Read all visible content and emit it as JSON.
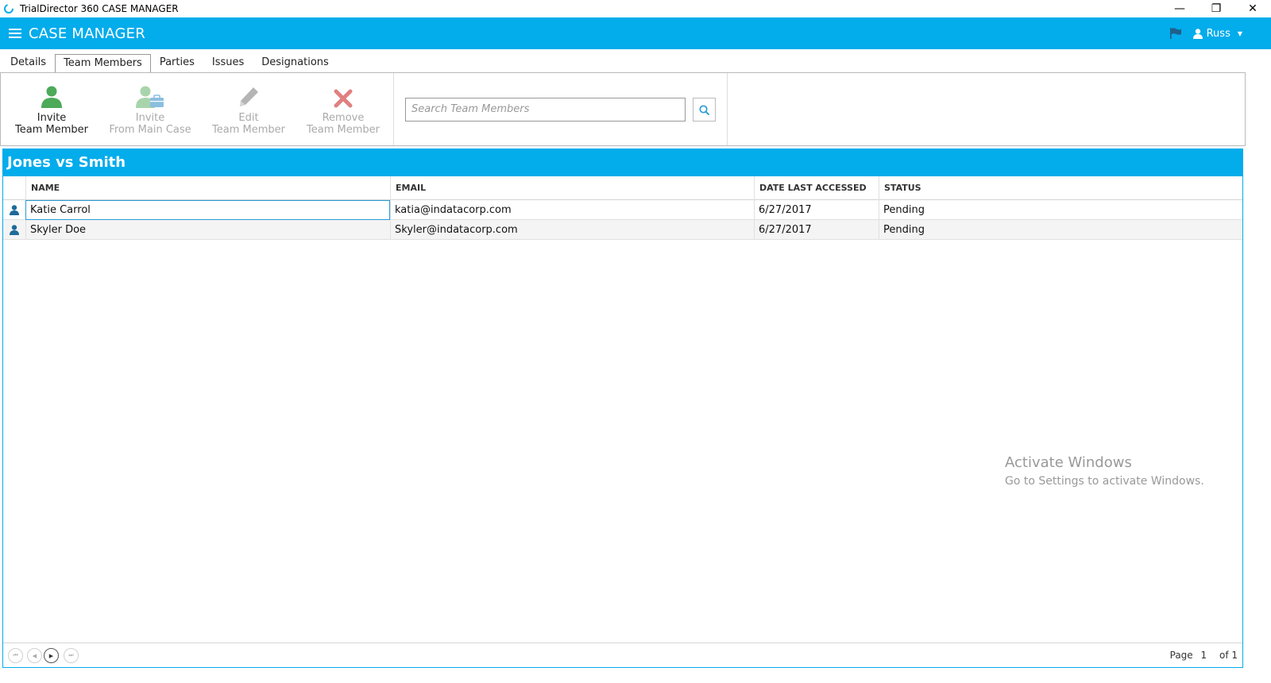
{
  "window": {
    "title": "TrialDirector 360 CASE MANAGER",
    "minimize": "—",
    "restore": "❐",
    "close": "✕"
  },
  "appbar": {
    "title": "CASE MANAGER",
    "user": "Russ"
  },
  "tabs": [
    {
      "label": "Details",
      "active": false
    },
    {
      "label": "Team Members",
      "active": true
    },
    {
      "label": "Parties",
      "active": false
    },
    {
      "label": "Issues",
      "active": false
    },
    {
      "label": "Designations",
      "active": false
    }
  ],
  "toolbar": {
    "invite": {
      "line1": "Invite",
      "line2": "Team Member",
      "icon": "user-add-icon"
    },
    "invite_main": {
      "line1": "Invite",
      "line2": "From Main Case",
      "icon": "user-briefcase-icon"
    },
    "edit": {
      "line1": "Edit",
      "line2": "Team Member",
      "icon": "pencil-icon"
    },
    "remove": {
      "line1": "Remove",
      "line2": "Team Member",
      "icon": "remove-x-icon"
    },
    "search_placeholder": "Search Team Members"
  },
  "grid": {
    "title": "Jones vs Smith",
    "columns": [
      "NAME",
      "EMAIL",
      "DATE LAST ACCESSED",
      "STATUS"
    ],
    "rows": [
      {
        "name": "Katie Carrol",
        "email": "katia@indatacorp.com",
        "date": "6/27/2017",
        "status": "Pending"
      },
      {
        "name": "Skyler Doe",
        "email": "Skyler@indatacorp.com",
        "date": "6/27/2017",
        "status": "Pending"
      }
    ]
  },
  "watermark": {
    "line1": "Activate Windows",
    "line2": "Go to Settings to activate Windows."
  },
  "pager": {
    "page_label": "Page",
    "page": "1",
    "of_label": "of 1"
  },
  "colors": {
    "accent": "#03aceb",
    "invite_green": "#4caa58",
    "remove_red": "#e08080",
    "user_icon_blue": "#1e6a9a"
  }
}
